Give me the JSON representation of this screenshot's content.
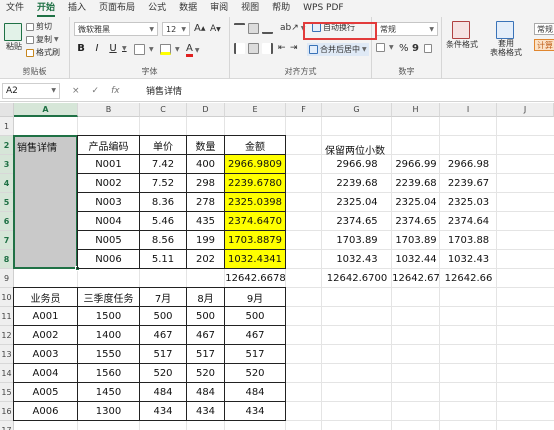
{
  "menu": {
    "tabs": [
      "文件",
      "开始",
      "插入",
      "页面布局",
      "公式",
      "数据",
      "审阅",
      "视图",
      "帮助",
      "WPS PDF"
    ]
  },
  "ribbon": {
    "clipboard": {
      "paste": "粘贴",
      "cut": "剪切",
      "copy": "复制",
      "format_painter": "格式刷",
      "label": "剪贴板"
    },
    "font": {
      "name": "微软雅黑",
      "size": "12",
      "grow": "A",
      "shrink": "A",
      "bold": "B",
      "italic": "I",
      "underline": "U",
      "label": "字体"
    },
    "alignment": {
      "wrap": "自动换行",
      "merge": "合并后居中",
      "label": "对齐方式"
    },
    "number": {
      "format": "常规",
      "percent": "%",
      "comma": "9",
      "label": "数字"
    },
    "styles": {
      "conditional": "条件格式",
      "table": "套用\n表格格式",
      "cell_style": "常规",
      "cell_style2": "计算"
    }
  },
  "formula_bar": {
    "name_box": "A2",
    "cancel": "×",
    "confirm": "✓",
    "fx": "fx",
    "value": "销售详情"
  },
  "sheet": {
    "columns": [
      "A",
      "B",
      "C",
      "D",
      "E",
      "F",
      "G",
      "H",
      "I",
      "J"
    ],
    "rows": [
      "1",
      "2",
      "3",
      "4",
      "5",
      "6",
      "7",
      "8",
      "9",
      "10",
      "11",
      "12",
      "13",
      "14",
      "15",
      "16",
      "17"
    ],
    "merged_label": "销售详情",
    "table1": {
      "headers": [
        "产品编码",
        "单价",
        "数量",
        "金额"
      ],
      "rows": [
        [
          "N001",
          "7.42",
          "400",
          "2966.9809"
        ],
        [
          "N002",
          "7.52",
          "298",
          "2239.6780"
        ],
        [
          "N003",
          "8.36",
          "278",
          "2325.0398"
        ],
        [
          "N004",
          "5.46",
          "435",
          "2374.6470"
        ],
        [
          "N005",
          "8.56",
          "199",
          "1703.8879"
        ],
        [
          "N006",
          "5.11",
          "202",
          "1032.4341"
        ]
      ],
      "total": "12642.6678"
    },
    "table2": {
      "headers": [
        "业务员",
        "三季度任务",
        "7月",
        "8月",
        "9月"
      ],
      "rows": [
        [
          "A001",
          "1500",
          "500",
          "500",
          "500"
        ],
        [
          "A002",
          "1400",
          "467",
          "467",
          "467"
        ],
        [
          "A003",
          "1550",
          "517",
          "517",
          "517"
        ],
        [
          "A004",
          "1560",
          "520",
          "520",
          "520"
        ],
        [
          "A005",
          "1450",
          "484",
          "484",
          "484"
        ],
        [
          "A006",
          "1300",
          "434",
          "434",
          "434"
        ]
      ]
    },
    "rounded": {
      "title": "保留两位小数",
      "rows": [
        [
          "2966.98",
          "2966.99",
          "2966.98"
        ],
        [
          "2239.68",
          "2239.68",
          "2239.67"
        ],
        [
          "2325.04",
          "2325.04",
          "2325.03"
        ],
        [
          "2374.65",
          "2374.65",
          "2374.64"
        ],
        [
          "1703.89",
          "1703.89",
          "1703.88"
        ],
        [
          "1032.43",
          "1032.44",
          "1032.43"
        ],
        [
          "12642.6700",
          "12642.67",
          "12642.66"
        ]
      ]
    }
  }
}
